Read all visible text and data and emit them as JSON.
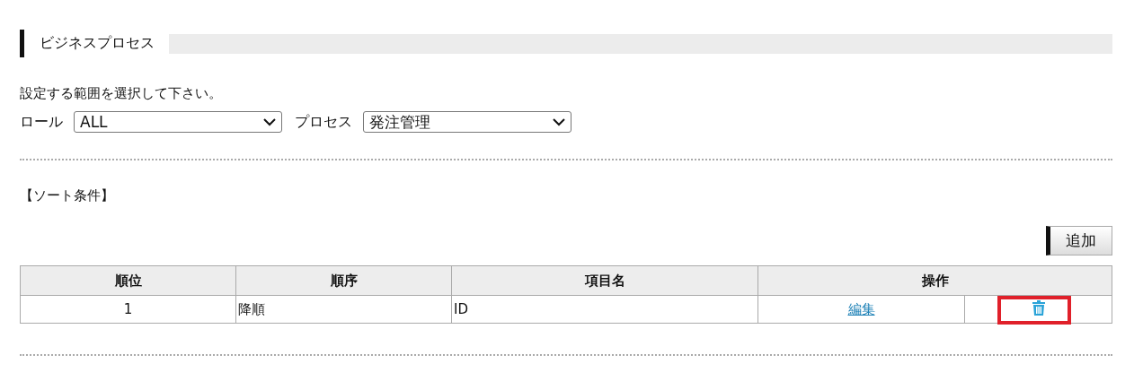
{
  "section": {
    "title": "ビジネスプロセス"
  },
  "instruction": "設定する範囲を選択して下さい。",
  "filters": [
    {
      "label": "ロール",
      "value": "ALL"
    },
    {
      "label": "プロセス",
      "value": "発注管理"
    }
  ],
  "sort": {
    "title": "【ソート条件】",
    "add_button": "追加",
    "columns": [
      "順位",
      "順序",
      "項目名",
      "操作"
    ],
    "rows": [
      {
        "rank": "1",
        "order": "降順",
        "field": "ID",
        "edit": "編集",
        "delete_highlighted": true
      }
    ]
  }
}
